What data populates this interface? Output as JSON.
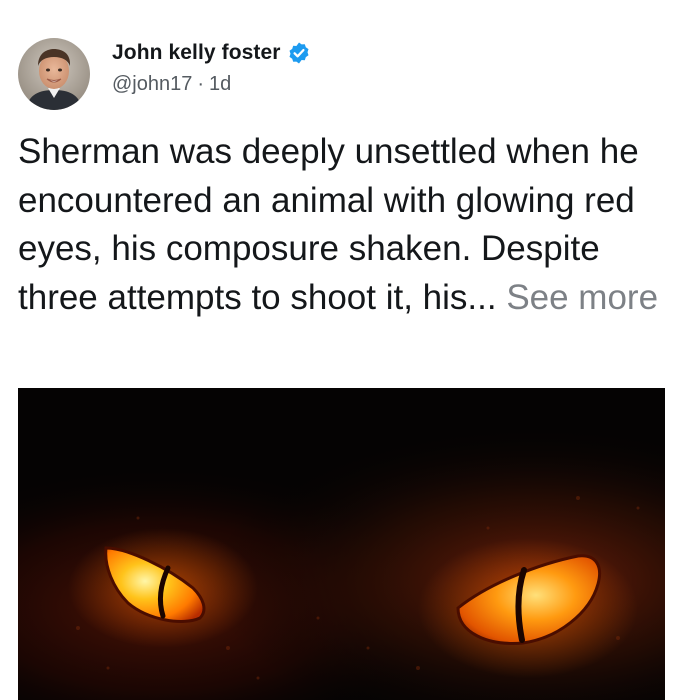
{
  "tweet": {
    "author": {
      "display_name": "John kelly foster",
      "handle": "@john17",
      "verified": true,
      "avatar_icon": "profile-photo"
    },
    "separator": "·",
    "timestamp": "1d",
    "text": "Sherman was deeply unsettled when he encountered an animal with glowing red eyes, his composure shaken. Despite three attempts to shoot it, his...",
    "see_more_label": "See more",
    "media": {
      "icon": "glowing-animal-eyes-image"
    }
  },
  "colors": {
    "verified_badge": "#1d9bf0",
    "secondary_text": "#555b61",
    "see_more": "#7d8186",
    "eye_glow": "#ff8a00"
  }
}
